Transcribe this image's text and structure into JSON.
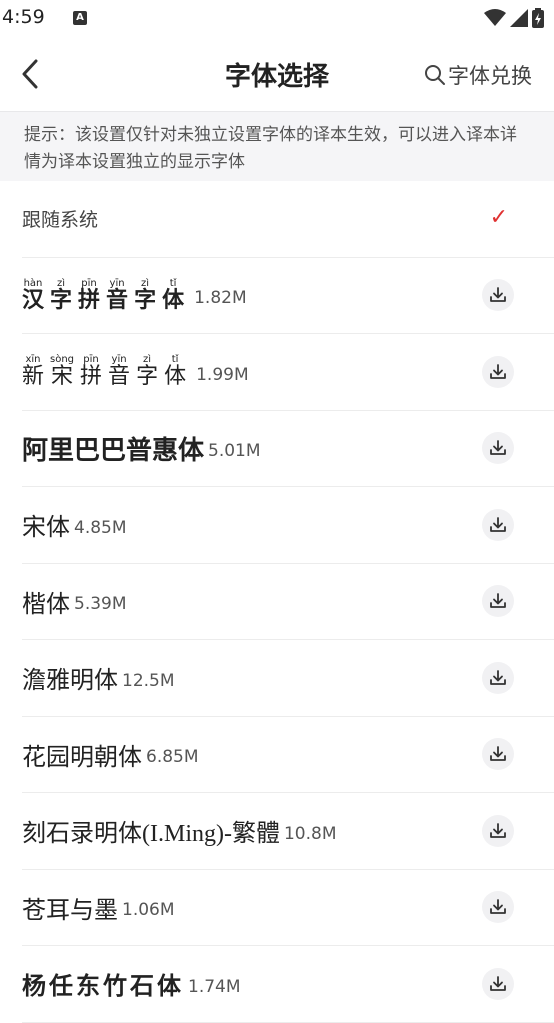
{
  "status": {
    "time": "4:59",
    "a_badge": "A"
  },
  "header": {
    "back_label": "‹",
    "title": "字体选择",
    "exchange_label": "字体兑换"
  },
  "hint": "提示：该设置仅针对未独立设置字体的译本生效，可以进入译本详情为译本设置独立的显示字体",
  "system_item": {
    "label": "跟随系统",
    "check": "✓"
  },
  "pinyin_fonts": [
    {
      "chars": [
        "汉",
        "字",
        "拼",
        "音",
        "字",
        "体"
      ],
      "pinyin": [
        "hàn",
        "zì",
        "pīn",
        "yīn",
        "zì",
        "tǐ"
      ],
      "size": "1.82M"
    },
    {
      "chars": [
        "新",
        "宋",
        "拼",
        "音",
        "字",
        "体"
      ],
      "pinyin": [
        "xīn",
        "sòng",
        "pīn",
        "yīn",
        "zì",
        "tǐ"
      ],
      "size": "1.99M"
    }
  ],
  "fonts": [
    {
      "name": "阿里巴巴普惠体",
      "size": "5.01M"
    },
    {
      "name": "宋体",
      "size": "4.85M"
    },
    {
      "name": "楷体",
      "size": "5.39M"
    },
    {
      "name": "澹雅明体",
      "size": "12.5M"
    },
    {
      "name": "花园明朝体",
      "size": "6.85M"
    },
    {
      "name": "刻石录明体(I.Ming)-繁體",
      "size": "10.8M"
    },
    {
      "name": "苍耳与墨",
      "size": "1.06M"
    },
    {
      "name": "杨任东竹石体",
      "size": "1.74M"
    }
  ],
  "icons": {
    "download": "download-icon",
    "search": "search-icon",
    "back": "back-arrow-icon"
  },
  "colors": {
    "check": "#e03131",
    "hint_bg": "#f5f5f7",
    "button_bg": "#f1f1f3"
  }
}
